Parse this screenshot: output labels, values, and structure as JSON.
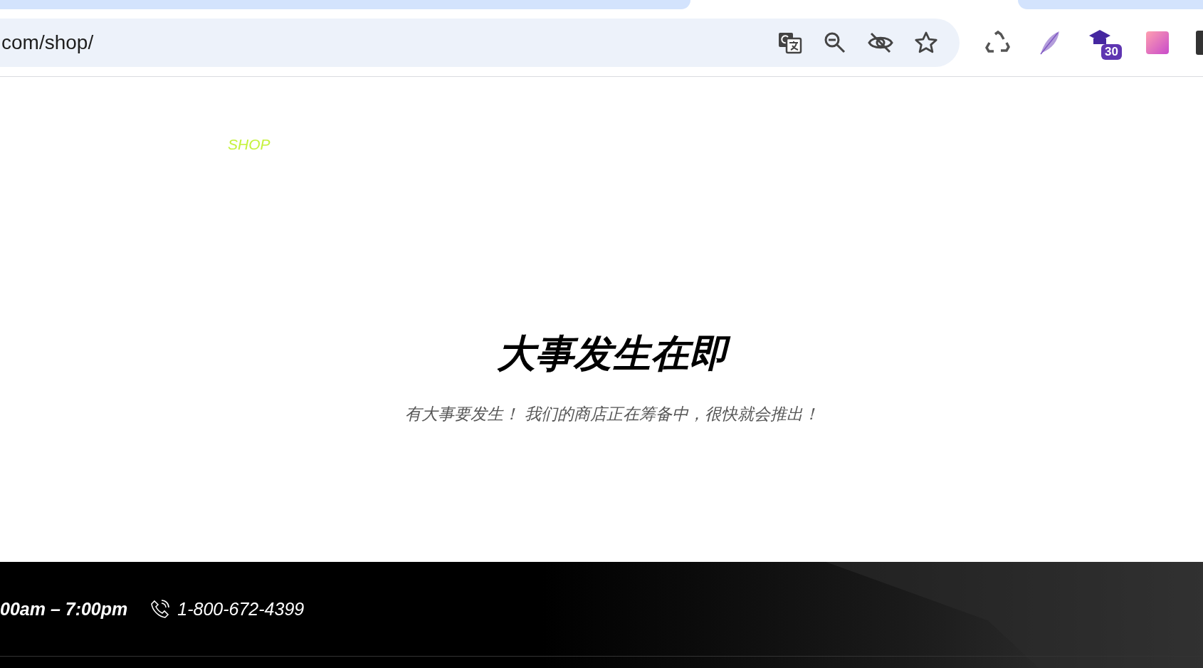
{
  "browser": {
    "url": "com/shop/",
    "extension_badge": "30"
  },
  "nav": {
    "item": "SHOP"
  },
  "hero": {
    "title": "大事发生在即",
    "subtitle": "有大事要发生！ 我们的商店正在筹备中，很快就会推出！"
  },
  "footer": {
    "hours": "00am – 7:00pm",
    "phone": "1-800-672-4399"
  }
}
